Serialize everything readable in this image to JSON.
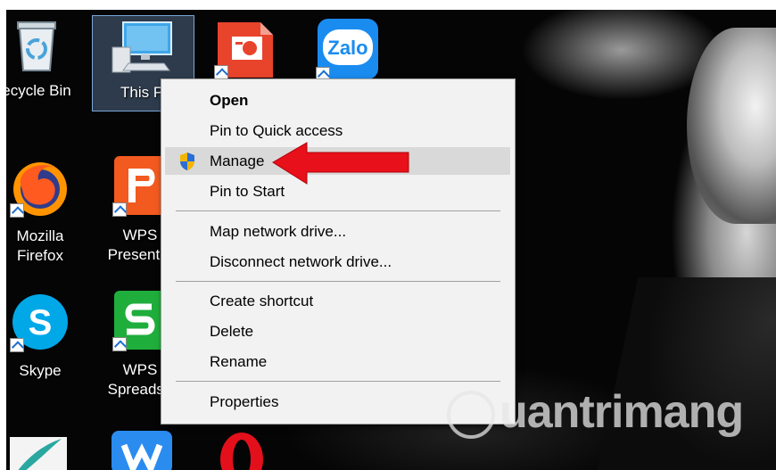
{
  "desktop_icons": [
    {
      "name": "recycle-bin",
      "label_lines": [
        "ecycle Bin"
      ]
    },
    {
      "name": "this-pc",
      "label_lines": [
        "This P"
      ]
    },
    {
      "name": "wps-presentation-top",
      "label_lines": [
        ""
      ]
    },
    {
      "name": "zalo",
      "label_lines": [
        ""
      ],
      "logo_text": "Zalo"
    },
    {
      "name": "mozilla-firefox",
      "label_lines": [
        "Mozilla",
        "Firefox"
      ]
    },
    {
      "name": "wps-presentation",
      "label_lines": [
        "WPS",
        "Presentat"
      ]
    },
    {
      "name": "skype",
      "label_lines": [
        "Skype"
      ]
    },
    {
      "name": "wps-spreadsheets",
      "label_lines": [
        "WPS",
        "Spreadsh"
      ]
    }
  ],
  "context_menu": {
    "items": [
      {
        "label": "Open",
        "bold": true
      },
      {
        "label": "Pin to Quick access"
      },
      {
        "label": "Manage",
        "icon": "uac-shield-icon",
        "highlighted": true
      },
      {
        "label": "Pin to Start"
      },
      {
        "label": "Map network drive..."
      },
      {
        "label": "Disconnect network drive..."
      },
      {
        "label": "Create shortcut"
      },
      {
        "label": "Delete"
      },
      {
        "label": "Rename"
      },
      {
        "label": "Properties"
      }
    ]
  },
  "annotation": {
    "arrow_color": "#e8101a",
    "points_to": "Manage"
  },
  "watermark": {
    "text": "uantrimang"
  },
  "colors": {
    "menu_bg": "#f2f2f2",
    "menu_hover": "#d9d9d9",
    "desktop_bg": "#050505"
  }
}
